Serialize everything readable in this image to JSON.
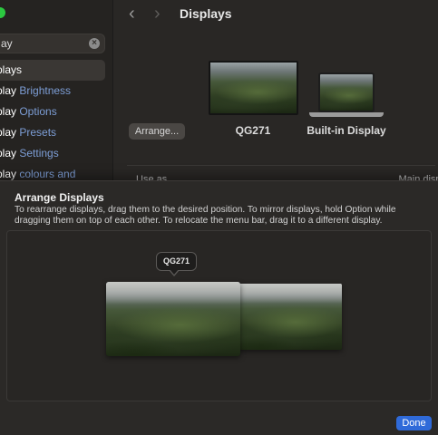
{
  "sidebar": {
    "search_value": "ay",
    "items": [
      {
        "prefix": "plays",
        "suffix": ""
      },
      {
        "prefix": "play",
        "suffix": " Brightness"
      },
      {
        "prefix": "play",
        "suffix": " Options"
      },
      {
        "prefix": "play",
        "suffix": " Presets"
      },
      {
        "prefix": "play",
        "suffix": " Settings"
      },
      {
        "prefix": "play",
        "suffix": " colours and"
      }
    ]
  },
  "window": {
    "title": "Displays",
    "arrange_button": "Arrange...",
    "displays": [
      "QG271",
      "Built-in Display"
    ],
    "use_as_label": "Use as",
    "use_as_value": "Main displ"
  },
  "sheet": {
    "title": "Arrange Displays",
    "description": "To rearrange displays, drag them to the desired position. To mirror displays, hold Option while dragging them on top of each other. To relocate the menu bar, drag it to a different display.",
    "tooltip": "QG271",
    "done_button": "Done"
  },
  "colors": {
    "accent": "#2f6ad9",
    "window_green": "#2bc840"
  },
  "icons": [
    "chevron-left-icon",
    "chevron-right-icon",
    "clear-search-icon"
  ]
}
